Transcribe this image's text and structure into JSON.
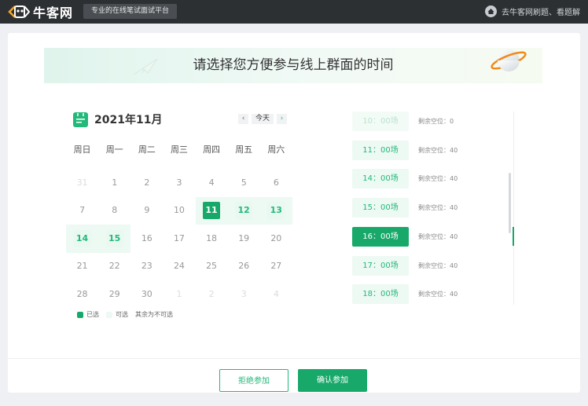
{
  "topbar": {
    "logo_text": "牛客网",
    "slogan": "专业的在线笔试面试平台",
    "link_text": "去牛客网刷题、看题解"
  },
  "banner": {
    "title": "请选择您方便参与线上群面的时间"
  },
  "calendar": {
    "title": "2021年11月",
    "prev": "‹",
    "today": "今天",
    "next": "›",
    "weekdays": [
      "周日",
      "周一",
      "周二",
      "周三",
      "周四",
      "周五",
      "周六"
    ],
    "days": [
      {
        "label": "31",
        "state": "other"
      },
      {
        "label": "1",
        "state": "normal"
      },
      {
        "label": "2",
        "state": "normal"
      },
      {
        "label": "3",
        "state": "normal"
      },
      {
        "label": "4",
        "state": "normal"
      },
      {
        "label": "5",
        "state": "normal"
      },
      {
        "label": "6",
        "state": "normal"
      },
      {
        "label": "7",
        "state": "normal"
      },
      {
        "label": "8",
        "state": "normal"
      },
      {
        "label": "9",
        "state": "normal"
      },
      {
        "label": "10",
        "state": "normal"
      },
      {
        "label": "11",
        "state": "selected"
      },
      {
        "label": "12",
        "state": "available"
      },
      {
        "label": "13",
        "state": "available"
      },
      {
        "label": "14",
        "state": "available"
      },
      {
        "label": "15",
        "state": "available"
      },
      {
        "label": "16",
        "state": "normal"
      },
      {
        "label": "17",
        "state": "normal"
      },
      {
        "label": "18",
        "state": "normal"
      },
      {
        "label": "19",
        "state": "normal"
      },
      {
        "label": "20",
        "state": "normal"
      },
      {
        "label": "21",
        "state": "normal"
      },
      {
        "label": "22",
        "state": "normal"
      },
      {
        "label": "23",
        "state": "normal"
      },
      {
        "label": "24",
        "state": "normal"
      },
      {
        "label": "25",
        "state": "normal"
      },
      {
        "label": "26",
        "state": "normal"
      },
      {
        "label": "27",
        "state": "normal"
      },
      {
        "label": "28",
        "state": "normal"
      },
      {
        "label": "29",
        "state": "normal"
      },
      {
        "label": "30",
        "state": "normal"
      },
      {
        "label": "1",
        "state": "other"
      },
      {
        "label": "2",
        "state": "other"
      },
      {
        "label": "3",
        "state": "other"
      },
      {
        "label": "4",
        "state": "other"
      }
    ],
    "legend": {
      "selected": "已选",
      "available": "可选",
      "unavailable": "其余为不可选"
    }
  },
  "slots": [
    {
      "time": "10：00场",
      "remain": "剩余空位：0",
      "state": "dim"
    },
    {
      "time": "11：00场",
      "remain": "剩余空位：40",
      "state": "normal"
    },
    {
      "time": "14：00场",
      "remain": "剩余空位：40",
      "state": "normal"
    },
    {
      "time": "15：00场",
      "remain": "剩余空位：40",
      "state": "normal"
    },
    {
      "time": "16：00场",
      "remain": "剩余空位：40",
      "state": "selected"
    },
    {
      "time": "17：00场",
      "remain": "剩余空位：40",
      "state": "normal"
    },
    {
      "time": "18：00场",
      "remain": "剩余空位：40",
      "state": "normal"
    }
  ],
  "buttons": {
    "reject": "拒绝参加",
    "confirm": "确认参加"
  },
  "colors": {
    "accent": "#18a96a",
    "topbar": "#2d3033"
  }
}
